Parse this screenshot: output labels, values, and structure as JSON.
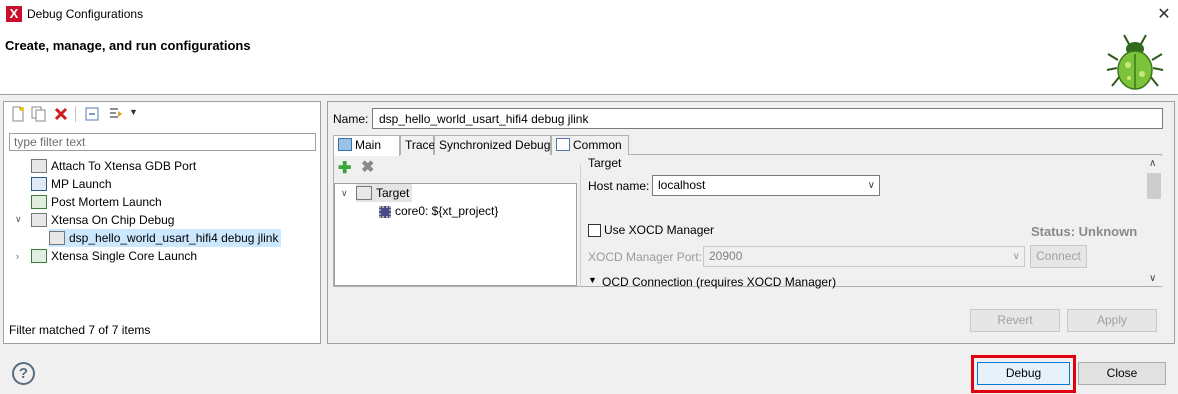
{
  "window": {
    "title": "Debug Configurations",
    "app_icon_letter": "X"
  },
  "banner": {
    "heading": "Create, manage, and run configurations"
  },
  "left": {
    "filter_placeholder": "type filter text",
    "tree": [
      {
        "label": "Attach To Xtensa GDB Port"
      },
      {
        "label": "MP Launch"
      },
      {
        "label": "Post Mortem Launch"
      },
      {
        "label": "Xtensa On Chip Debug",
        "expanded": true
      },
      {
        "label": "dsp_hello_world_usart_hifi4 debug jlink",
        "selected": true
      },
      {
        "label": "Xtensa Single Core Launch",
        "expanded": false
      }
    ],
    "filter_status": "Filter matched 7 of 7 items"
  },
  "right": {
    "name_label": "Name:",
    "name_value": "dsp_hello_world_usart_hifi4 debug jlink",
    "tabs": [
      {
        "label": "Main",
        "active": true
      },
      {
        "label": "Trace"
      },
      {
        "label": "Synchronized Debug"
      },
      {
        "label": "Common"
      }
    ],
    "main_tree": [
      {
        "label": "Target"
      },
      {
        "label": "core0: ${xt_project}"
      }
    ],
    "target_group": "Target",
    "host_label": "Host name:",
    "host_value": "localhost",
    "use_xocd_label": "Use XOCD Manager",
    "status_label": "Status: Unknown",
    "xocd_port_label": "XOCD Manager Port:",
    "xocd_port_value": "20900",
    "connect_label": "Connect",
    "ocd_connection_label": "OCD Connection (requires XOCD Manager)",
    "revert_label": "Revert",
    "apply_label": "Apply"
  },
  "footer": {
    "help_glyph": "?",
    "debug_label": "Debug",
    "close_label": "Close"
  },
  "colors": {
    "highlight": "#e0000f",
    "selection": "#cce8ff",
    "accent": "#0078d7"
  }
}
